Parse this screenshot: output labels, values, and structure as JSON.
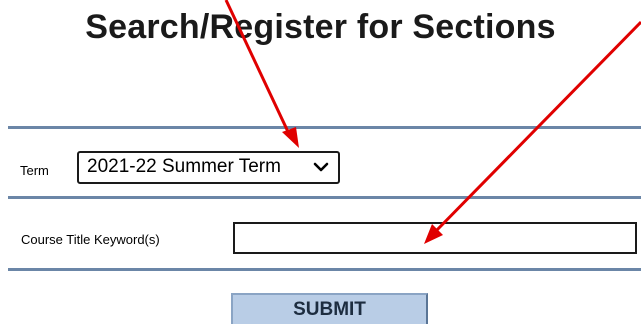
{
  "page": {
    "title": "Search/Register for Sections"
  },
  "form": {
    "term_label": "Term",
    "term_selected": "2021-22 Summer Term",
    "keyword_label": "Course Title Keyword(s)",
    "keyword_value": "",
    "submit_label": "SUBMIT"
  },
  "annotations": {
    "arrow_color": "#e00000"
  },
  "colors": {
    "rule": "#6b86a7",
    "submit_bg": "#b9cde6"
  }
}
